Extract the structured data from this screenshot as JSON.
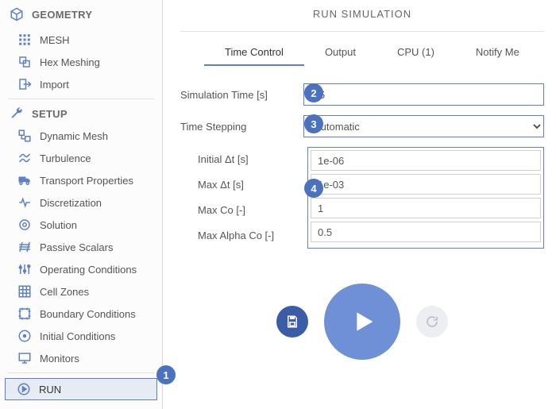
{
  "sidebar": {
    "groups": [
      {
        "header": "GEOMETRY",
        "items": [
          {
            "label": "MESH"
          },
          {
            "label": "Hex Meshing"
          },
          {
            "label": "Import"
          }
        ]
      },
      {
        "header": "SETUP",
        "items": [
          {
            "label": "Dynamic Mesh"
          },
          {
            "label": "Turbulence"
          },
          {
            "label": "Transport Properties"
          },
          {
            "label": "Discretization"
          },
          {
            "label": "Solution"
          },
          {
            "label": "Passive Scalars"
          },
          {
            "label": "Operating Conditions"
          },
          {
            "label": "Cell Zones"
          },
          {
            "label": "Boundary Conditions"
          },
          {
            "label": "Initial Conditions"
          },
          {
            "label": "Monitors"
          }
        ]
      }
    ],
    "run_label": "RUN"
  },
  "main": {
    "title": "RUN SIMULATION",
    "tabs": {
      "time_control": "Time Control",
      "output": "Output",
      "cpu": "CPU  (1)",
      "notify": "Notify Me"
    },
    "form": {
      "sim_time_label": "Simulation Time [s]",
      "sim_time_value": "1.5",
      "time_stepping_label": "Time Stepping",
      "time_stepping_value": "Automatic",
      "initial_dt_label": "Initial Δt [s]",
      "initial_dt_value": "1e-06",
      "max_dt_label": "Max Δt [s]",
      "max_dt_value": "1e-03",
      "max_co_label": "Max Co [-]",
      "max_co_value": "1",
      "max_alpha_co_label": "Max Alpha Co [-]",
      "max_alpha_co_value": "0.5"
    }
  },
  "badges": {
    "b1": "1",
    "b2": "2",
    "b3": "3",
    "b4": "4"
  }
}
